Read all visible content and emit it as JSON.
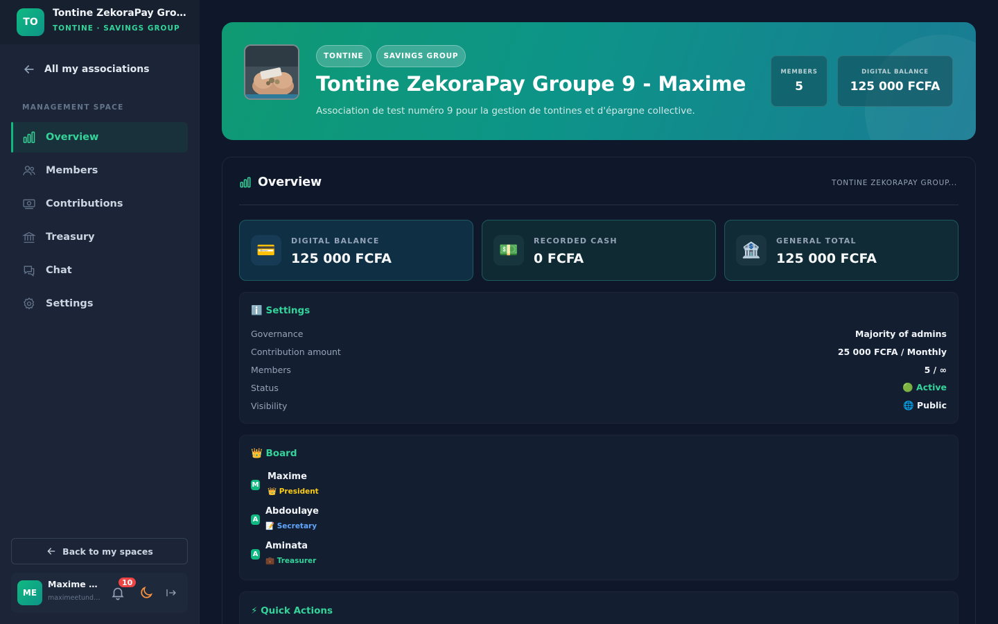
{
  "org": {
    "initials": "TO",
    "name": "Tontine ZekoraPay Groupe 9 - Maxime",
    "subtitle": "TONTINE · SAVINGS GROUP"
  },
  "sidebar": {
    "back_link": "All my associations",
    "section_label": "MANAGEMENT SPACE",
    "items": [
      {
        "label": "Overview",
        "icon": "bar-chart-icon",
        "active": true
      },
      {
        "label": "Members",
        "icon": "users-icon"
      },
      {
        "label": "Contributions",
        "icon": "cash-icon"
      },
      {
        "label": "Treasury",
        "icon": "bank-icon"
      },
      {
        "label": "Chat",
        "icon": "chat-icon"
      },
      {
        "label": "Settings",
        "icon": "gear-icon"
      }
    ],
    "back_spaces": "Back to my spaces"
  },
  "user": {
    "initials": "ME",
    "name": "Maxime Etunde",
    "email": "maximeetunde@example.com",
    "notifications": "10"
  },
  "hero": {
    "tags": [
      "TONTINE",
      "SAVINGS GROUP"
    ],
    "title": "Tontine ZekoraPay Groupe 9 - Maxime",
    "description": "Association de test numéro 9 pour la gestion de tontines et d'épargne collective.",
    "stats": [
      {
        "label": "MEMBERS",
        "value": "5"
      },
      {
        "label": "DIGITAL BALANCE",
        "value": "125 000 FCFA"
      }
    ]
  },
  "overview": {
    "title": "Overview",
    "org_label": "TONTINE ZEKORAPAY GROUP...",
    "cards": [
      {
        "label": "DIGITAL BALANCE",
        "value": "125 000 FCFA",
        "icon": "💳",
        "color": "#0f2f45"
      },
      {
        "label": "RECORDED CASH",
        "value": "0 FCFA",
        "icon": "💵",
        "color": "#102a33"
      },
      {
        "label": "GENERAL TOTAL",
        "value": "125 000 FCFA",
        "icon": "🏦",
        "color": "#112b36"
      }
    ]
  },
  "settings": {
    "title": "ℹ️ Settings",
    "rows": [
      {
        "key": "Governance",
        "value": "Majority of admins"
      },
      {
        "key": "Contribution amount",
        "value": "25 000 FCFA / Monthly"
      },
      {
        "key": "Members",
        "value": "5 / ∞"
      },
      {
        "key": "Status",
        "value": "🟢 Active"
      },
      {
        "key": "Visibility",
        "value": "🌐 Public"
      }
    ]
  },
  "board": {
    "title": "👑 Board",
    "members": [
      {
        "initial": "M",
        "name": "Maxime",
        "role": "👑 President",
        "color": "#facc15"
      },
      {
        "initial": "A",
        "name": "Abdoulaye",
        "role": "📝 Secretary",
        "color": "#60a5fa"
      },
      {
        "initial": "A",
        "name": "Aminata",
        "role": "💼 Treasurer",
        "color": "#34d399"
      }
    ]
  },
  "quick_actions": {
    "title": "⚡ Quick Actions"
  }
}
